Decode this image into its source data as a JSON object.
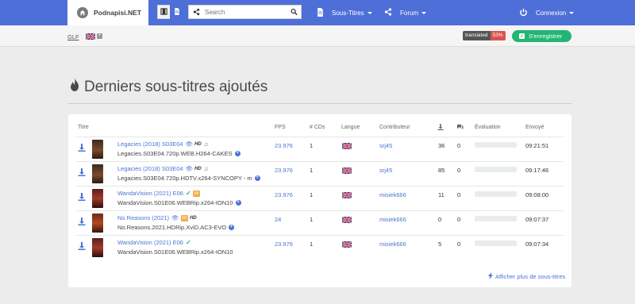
{
  "brand": {
    "name": "Podnapisi.NET"
  },
  "search": {
    "placeholder": "Search"
  },
  "nav": {
    "subtitles": "Sous-Titres",
    "forum": "Forum",
    "login": "Connexion"
  },
  "breadcrumb": {
    "glf": "GLF"
  },
  "translated_badge": {
    "label": "translated",
    "percent": "53%"
  },
  "register_label": "S'enregistrer",
  "page_title": "Derniers sous-titres ajoutés",
  "table": {
    "headers": {
      "title": "Titre",
      "fps": "FPS",
      "cds": "# CDs",
      "language": "Langue",
      "contributor": "Contributeur",
      "rating": "Évaluation",
      "sent": "Envoyé"
    },
    "rows": [
      {
        "title": "Legacies (2018) S03E04",
        "release": "Legacies.S03E04.720p.WEB.H264-CAKES",
        "fps": "23.976",
        "cds": "1",
        "contributor": "srj45",
        "downloads": "36",
        "comments": "0",
        "sent": "09:21:51",
        "rating": 0
      },
      {
        "title": "Legacies (2018) S03E04",
        "release": "Legacies.S03E04.720p.HDTV.x264-SYNCOPY - m",
        "fps": "23.976",
        "cds": "1",
        "contributor": "srj45",
        "downloads": "85",
        "comments": "0",
        "sent": "09:17:46",
        "rating": 0
      },
      {
        "title": "WandaVision (2021) E06",
        "release": "WandaVision.S01E06.WEBRip.x264-ION10",
        "fps": "23.976",
        "cds": "1",
        "contributor": "misiek666",
        "downloads": "11",
        "comments": "0",
        "sent": "09:08:00",
        "rating": 0
      },
      {
        "title": "No Reasons (2021)",
        "release": "No.Reasons.2021.HDRip.XviD.AC3-EVO",
        "fps": "24",
        "cds": "1",
        "contributor": "misiek666",
        "downloads": "0",
        "comments": "0",
        "sent": "09:07:37",
        "rating": 0
      },
      {
        "title": "WandaVision (2021) E06",
        "release": "WandaVision.S01E06.WEBRip.x264-ION10",
        "fps": "23.976",
        "cds": "1",
        "contributor": "misiek666",
        "downloads": "5",
        "comments": "0",
        "sent": "09:07:34",
        "rating": 0
      }
    ]
  },
  "more_link": "Afficher plus de sous-titres",
  "colors": {
    "accent": "#4f6fd8",
    "link": "#4a73d6",
    "success": "#22b573",
    "danger": "#d9534f"
  }
}
